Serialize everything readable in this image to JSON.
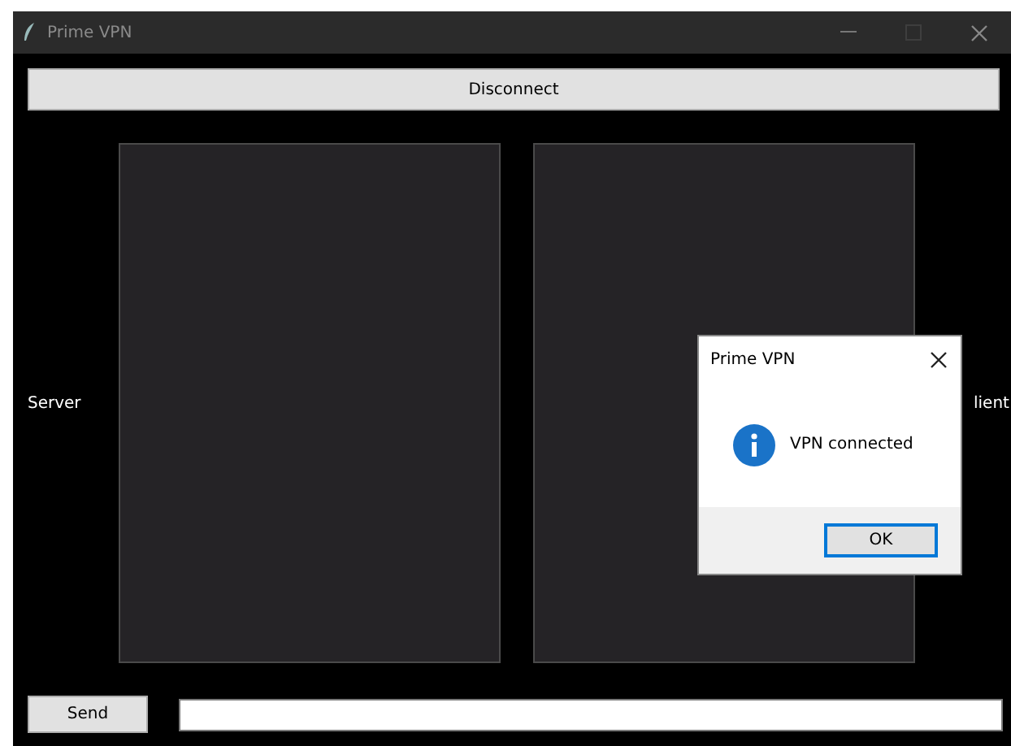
{
  "window": {
    "title": "Prime VPN"
  },
  "disconnect_button": "Disconnect",
  "server_label": "Server",
  "client_label": "lient",
  "send_button": "Send",
  "dialog": {
    "title": "Prime VPN",
    "message": "VPN connected",
    "button": "OK"
  }
}
